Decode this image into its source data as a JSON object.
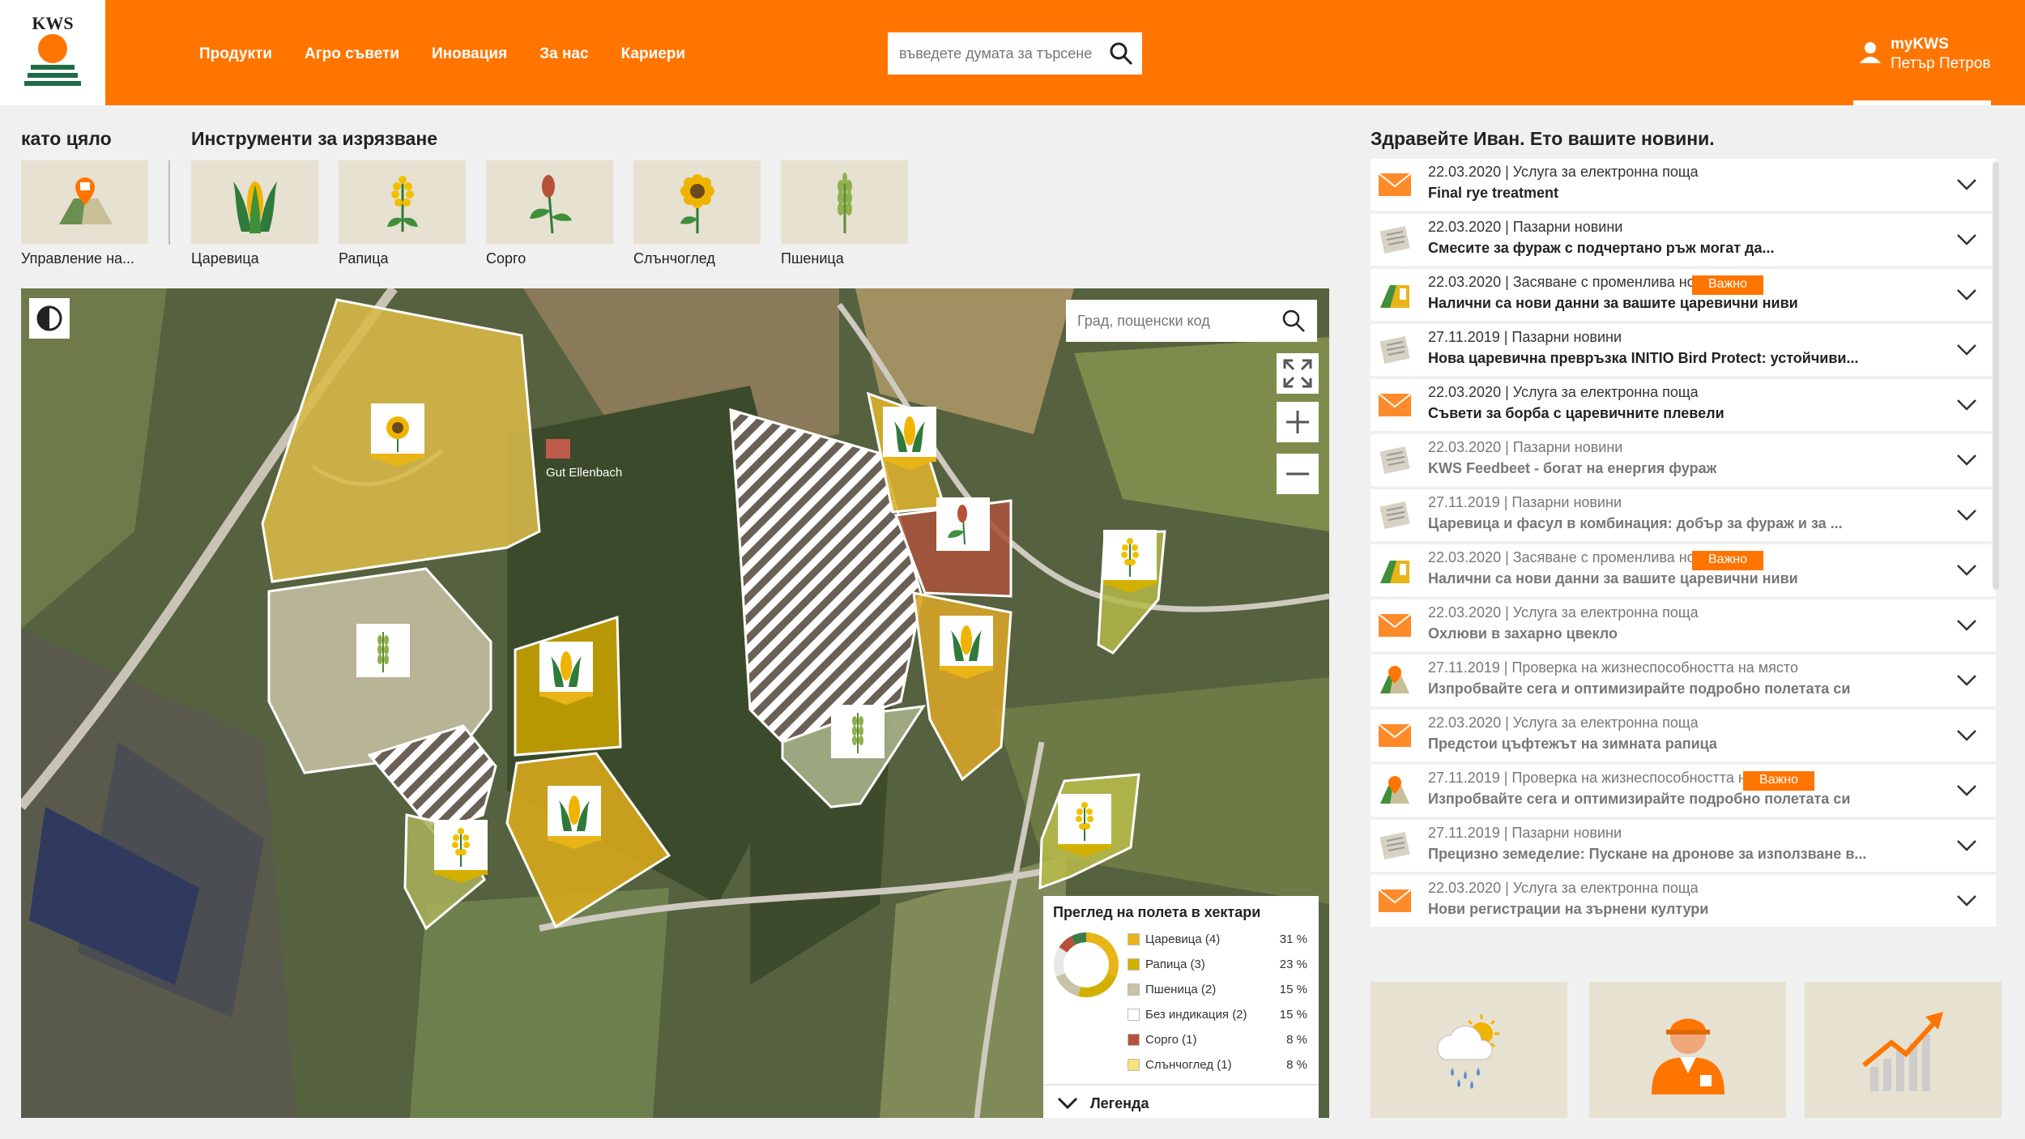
{
  "header": {
    "brand": "KWS",
    "nav": [
      "Продукти",
      "Агро съвети",
      "Иновация",
      "За нас",
      "Кариери"
    ],
    "search_placeholder": "въведете думата за търсене",
    "user_title": "myKWS",
    "user_name": "Петър Петров"
  },
  "tools": {
    "group1_title": "като цяло",
    "group2_title": "Инструменти за изрязване",
    "items": [
      {
        "label": "Управление на...",
        "icon": "field-management-icon"
      },
      {
        "label": "Царевица",
        "icon": "corn-icon"
      },
      {
        "label": "Рапица",
        "icon": "rapeseed-icon"
      },
      {
        "label": "Сорго",
        "icon": "sorghum-icon"
      },
      {
        "label": "Слънчоглед",
        "icon": "sunflower-icon"
      },
      {
        "label": "Пшеница",
        "icon": "wheat-icon"
      }
    ]
  },
  "map": {
    "search_placeholder": "Град, пощенски код",
    "place_label": "Gut Ellenbach",
    "legend_title": "Преглед на полета в хектари",
    "legend_footer": "Легенда",
    "legend": [
      {
        "name": "Царевица (4)",
        "percent": "31 %",
        "color": "#e8b418"
      },
      {
        "name": "Рапица (3)",
        "percent": "23 %",
        "color": "#d2b000"
      },
      {
        "name": "Пшеница (2)",
        "percent": "15 %",
        "color": "#c9c3a6"
      },
      {
        "name": "Без индикация (2)",
        "percent": "15 %",
        "color": "#ffffff"
      },
      {
        "name": "Сорго (1)",
        "percent": "8 %",
        "color": "#b6523a"
      },
      {
        "name": "Слънчоглед (1)",
        "percent": "8 %",
        "color": "#f6e27a"
      }
    ]
  },
  "news": {
    "title": "Здравейте Иван. Ето вашите новини.",
    "important_label": "Важно",
    "items": [
      {
        "meta": "22.03.2020 | Услуга за електронна поща",
        "headline": "Final rye treatment",
        "icon": "envelope-icon",
        "important": false,
        "read": false
      },
      {
        "meta": "22.03.2020 | Пазарни новини",
        "headline": "Смесите за фураж с подчертано ръж могат да...",
        "icon": "newspaper-icon",
        "important": false,
        "read": false
      },
      {
        "meta": "22.03.2020 | Засяване с променлива норма",
        "headline": "Налични са нови данни за вашите царевични ниви",
        "icon": "variable-seeding-icon",
        "important": true,
        "read": false
      },
      {
        "meta": "27.11.2019 | Пазарни новини",
        "headline": "Нова царевична превръзка INITIO Bird Protect: устойчиви...",
        "icon": "newspaper-icon",
        "important": false,
        "read": false
      },
      {
        "meta": "22.03.2020 | Услуга за електронна поща",
        "headline": "Съвети за борба с царевичните плевели",
        "icon": "envelope-icon",
        "important": false,
        "read": false
      },
      {
        "meta": "22.03.2020 | Пазарни новини",
        "headline": "KWS Feedbeet - богат на енергия фураж",
        "icon": "newspaper-icon",
        "important": false,
        "read": true
      },
      {
        "meta": "27.11.2019 | Пазарни новини",
        "headline": "Царевица и фасул в комбинация: добър за фураж и за ...",
        "icon": "newspaper-icon",
        "important": false,
        "read": true
      },
      {
        "meta": "22.03.2020 | Засяване с променлива норма",
        "headline": "Налични са нови данни за вашите царевични ниви",
        "icon": "variable-seeding-icon",
        "important": true,
        "read": true
      },
      {
        "meta": "22.03.2020 | Услуга за електронна поща",
        "headline": "Охлюви в захарно цвекло",
        "icon": "envelope-icon",
        "important": false,
        "read": true
      },
      {
        "meta": "27.11.2019 | Проверка на жизнеспособността на място",
        "headline": "Изпробвайте сега и оптимизирайте подробно полетата си",
        "icon": "field-check-icon",
        "important": false,
        "read": true
      },
      {
        "meta": "22.03.2020 | Услуга за електронна поща",
        "headline": "Предстои цъфтежът на зимната рапица",
        "icon": "envelope-icon",
        "important": false,
        "read": true
      },
      {
        "meta": "27.11.2019 | Проверка на жизнеспособността на място",
        "headline": "Изпробвайте сега и оптимизирайте подробно полетата си",
        "icon": "field-check-icon",
        "important": true,
        "read": true
      },
      {
        "meta": "27.11.2019 | Пазарни новини",
        "headline": "Прецизно земеделие: Пускане на дронове за използване в...",
        "icon": "newspaper-icon",
        "important": false,
        "read": true
      },
      {
        "meta": "22.03.2020 | Услуга за електронна поща",
        "headline": "Нови регистрации на зърнени култури",
        "icon": "envelope-icon",
        "important": false,
        "read": true
      }
    ]
  },
  "tiles": [
    {
      "icon": "weather-icon"
    },
    {
      "icon": "advisor-icon"
    },
    {
      "icon": "market-chart-icon"
    }
  ]
}
